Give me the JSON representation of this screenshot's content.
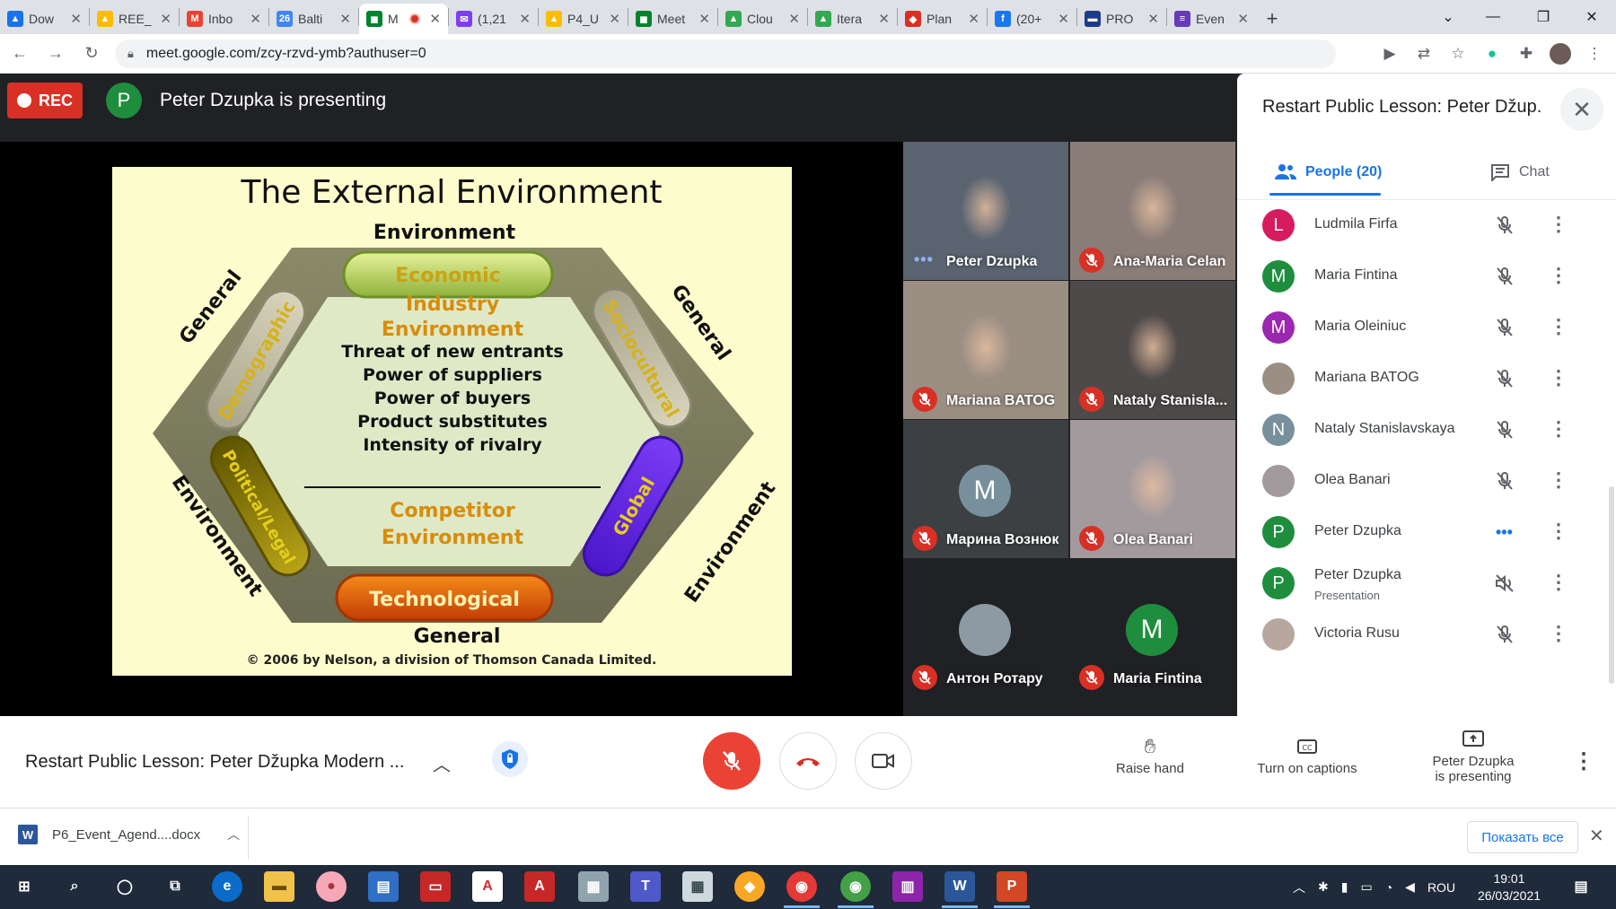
{
  "browser": {
    "tabs": [
      {
        "label": "Dow",
        "icon": "google-drive-icon",
        "color": "#1a73e8",
        "glyph": "▲",
        "active": false
      },
      {
        "label": "REE_",
        "icon": "google-drive-icon",
        "color": "#fbbc04",
        "glyph": "▲",
        "active": false
      },
      {
        "label": "Inbo",
        "icon": "gmail-icon",
        "color": "#ea4335",
        "glyph": "M",
        "active": false
      },
      {
        "label": "Balti",
        "icon": "calendar-icon",
        "color": "#4285f4",
        "glyph": "26",
        "active": false
      },
      {
        "label": "M",
        "icon": "meet-icon",
        "color": "#00832d",
        "glyph": "◼",
        "active": true
      },
      {
        "label": "(1,21",
        "icon": "mail-icon",
        "color": "#7e3ff2",
        "glyph": "✉",
        "active": false
      },
      {
        "label": "P4_U",
        "icon": "google-drive-icon",
        "color": "#fbbc04",
        "glyph": "▲",
        "active": false
      },
      {
        "label": "Meet",
        "icon": "meet-icon",
        "color": "#00832d",
        "glyph": "◼",
        "active": false
      },
      {
        "label": "Clou",
        "icon": "google-drive-icon",
        "color": "#34a853",
        "glyph": "▲",
        "active": false
      },
      {
        "label": "Itera",
        "icon": "google-drive-icon",
        "color": "#34a853",
        "glyph": "▲",
        "active": false
      },
      {
        "label": "Plan",
        "icon": "planner-icon",
        "color": "#d93025",
        "glyph": "◆",
        "active": false
      },
      {
        "label": "(20+",
        "icon": "facebook-icon",
        "color": "#1877f2",
        "glyph": "f",
        "active": false
      },
      {
        "label": "PRO",
        "icon": "pro-icon",
        "color": "#1e3a8a",
        "glyph": "▬",
        "active": false
      },
      {
        "label": "Even",
        "icon": "forms-icon",
        "color": "#673ab7",
        "glyph": "≡",
        "active": false
      }
    ],
    "url": "meet.google.com/zcy-rzvd-ymb?authuser=0"
  },
  "meeting": {
    "rec_label": "REC",
    "presenter_initial": "P",
    "presenting_text": "Peter Dzupka is presenting",
    "title": "Restart Public Lesson: Peter Džupka Modern ...",
    "panel_title": "Restart Public Lesson: Peter Džup...",
    "people_tab": "People (20)",
    "chat_tab": "Chat"
  },
  "slide": {
    "title": "The External Environment",
    "top_label": "Environment",
    "bottom_label": "General",
    "left_top": "General",
    "right_top": "General",
    "left_bottom": "Environment",
    "right_bottom": "Environment",
    "pills": [
      "Economic",
      "Demographic",
      "Sociocultural",
      "Political/Legal",
      "Global",
      "Technological"
    ],
    "center_heading1": "Industry",
    "center_heading2": "Environment",
    "forces": [
      "Threat of new entrants",
      "Power of suppliers",
      "Power of buyers",
      "Product substitutes",
      "Intensity of rivalry"
    ],
    "competitor1": "Competitor",
    "competitor2": "Environment",
    "copyright": "© 2006 by Nelson, a division of Thomson Canada Limited."
  },
  "tiles": [
    {
      "name": "Peter Dzupka",
      "status": "speaking",
      "bg": "#5a6470"
    },
    {
      "name": "Ana-Maria Celan",
      "status": "muted",
      "bg": "#8a7d78"
    },
    {
      "name": "Mariana BATOG",
      "status": "muted",
      "bg": "#9b8f84"
    },
    {
      "name": "Nataly Stanisla...",
      "status": "muted",
      "bg": "#4f4a4a"
    },
    {
      "name": "Марина Вознюк",
      "status": "muted",
      "initial": "M",
      "avatar_color": "#78909c",
      "bg": "#3c4043"
    },
    {
      "name": "Olea Banari",
      "status": "muted",
      "bg": "#a39a9d"
    },
    {
      "name": "Антон Ротару",
      "status": "muted",
      "initial": "",
      "avatar_color": "#8d9aa3",
      "bg": "#202124"
    },
    {
      "name": "Maria Fintina",
      "status": "muted",
      "initial": "M",
      "avatar_color": "#1e8e3e",
      "bg": "#202124"
    }
  ],
  "people": [
    {
      "name": "Ludmila Firfa",
      "initial": "L",
      "color": "#d81b60",
      "sub": "",
      "state": "muted"
    },
    {
      "name": "Maria Fintina",
      "initial": "M",
      "color": "#1e8e3e",
      "sub": "",
      "state": "muted"
    },
    {
      "name": "Maria Oleiniuc",
      "initial": "M",
      "color": "#9c27b0",
      "sub": "",
      "state": "muted"
    },
    {
      "name": "Mariana BATOG",
      "initial": "",
      "color": "#9b8f84",
      "sub": "",
      "state": "muted"
    },
    {
      "name": "Nataly Stanislavskaya",
      "initial": "N",
      "color": "#78909c",
      "sub": "",
      "state": "muted"
    },
    {
      "name": "Olea Banari",
      "initial": "",
      "color": "#a39a9d",
      "sub": "",
      "state": "muted"
    },
    {
      "name": "Peter Dzupka",
      "initial": "P",
      "color": "#1e8e3e",
      "sub": "",
      "state": "speaking"
    },
    {
      "name": "Peter Dzupka",
      "initial": "P",
      "color": "#1e8e3e",
      "sub": "Presentation",
      "state": "audio-off"
    },
    {
      "name": "Victoria Rusu",
      "initial": "",
      "color": "#b8a79e",
      "sub": "",
      "state": "muted"
    }
  ],
  "controls": {
    "raise_hand": "Raise hand",
    "captions": "Turn on captions",
    "presenting_line1": "Peter Dzupka",
    "presenting_line2": "is presenting"
  },
  "downloads": {
    "file": "P6_Event_Agend....docx",
    "show_all": "Показать все"
  },
  "taskbar": {
    "language": "ROU",
    "time": "19:01",
    "date": "26/03/2021"
  },
  "colors": {
    "meet_red": "#ea4335",
    "accent_blue": "#1a73e8",
    "stage_bg": "#202124"
  }
}
